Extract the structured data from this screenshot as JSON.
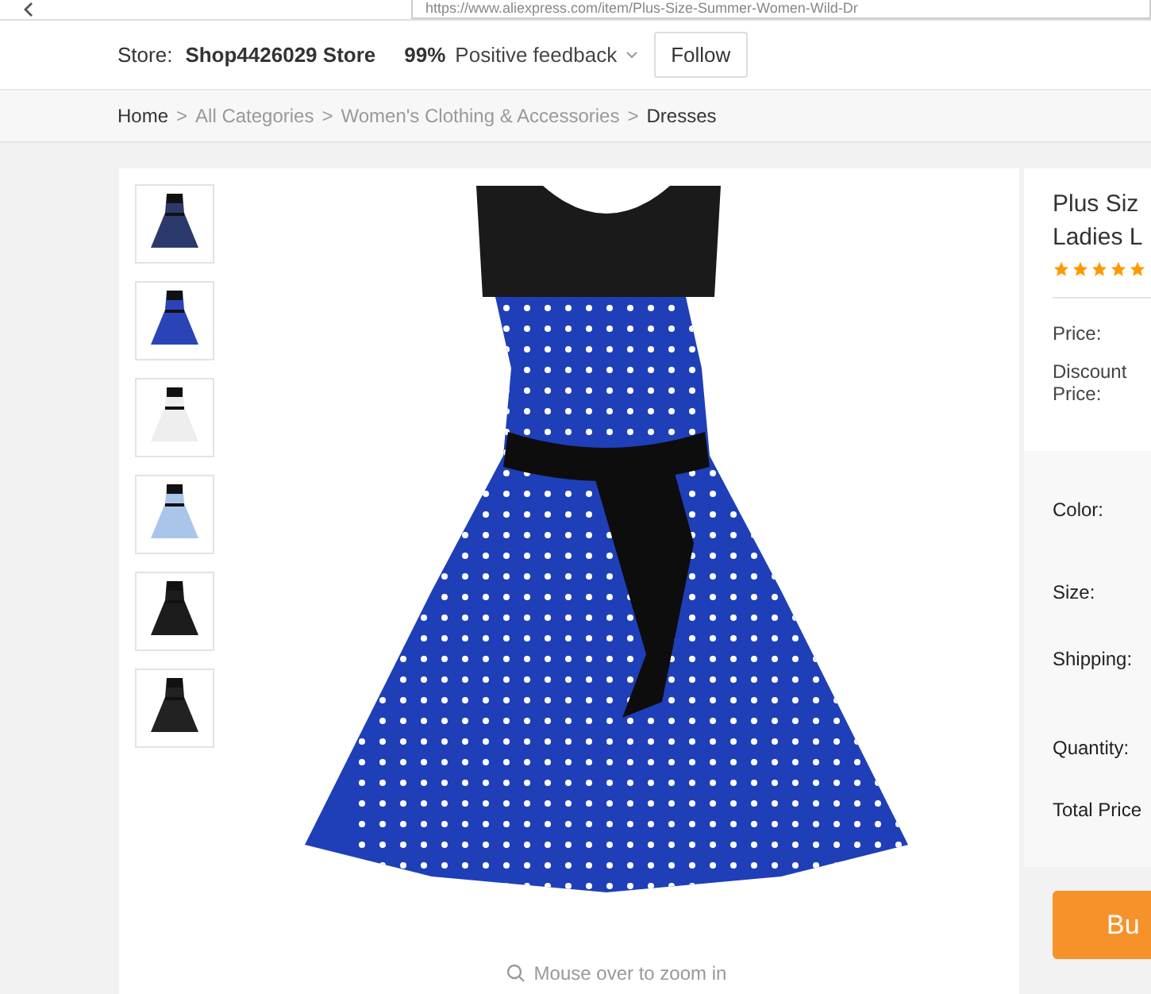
{
  "browser": {
    "url": "https://www.aliexpress.com/item/Plus-Size-Summer-Women-Wild-Dr"
  },
  "store_bar": {
    "store_label": "Store:",
    "store_name": "Shop4426029 Store",
    "feedback_percent": "99%",
    "feedback_label": "Positive feedback",
    "follow_button": "Follow"
  },
  "breadcrumb": [
    {
      "label": "Home"
    },
    {
      "label": "All Categories"
    },
    {
      "label": "Women's Clothing & Accessories"
    },
    {
      "label": "Dresses"
    }
  ],
  "breadcrumb_separator": ">",
  "thumbnails": [
    {
      "color": "#2b3a6b"
    },
    {
      "color": "#2a44b8"
    },
    {
      "color": "#eeeeee"
    },
    {
      "color": "#a9c6ea"
    },
    {
      "color": "#1c1c1c"
    },
    {
      "color": "#222222"
    }
  ],
  "zoom_hint": "Mouse over to zoom in",
  "product": {
    "title_lines": [
      "Plus Siz",
      "Ladies L"
    ],
    "stars": 5,
    "price_label": "Price:",
    "discount_label": "Discount Price:",
    "options": [
      "Color:",
      "Size:",
      "Shipping:",
      "Quantity:",
      "Total Price"
    ],
    "buy_button": "Bu"
  }
}
